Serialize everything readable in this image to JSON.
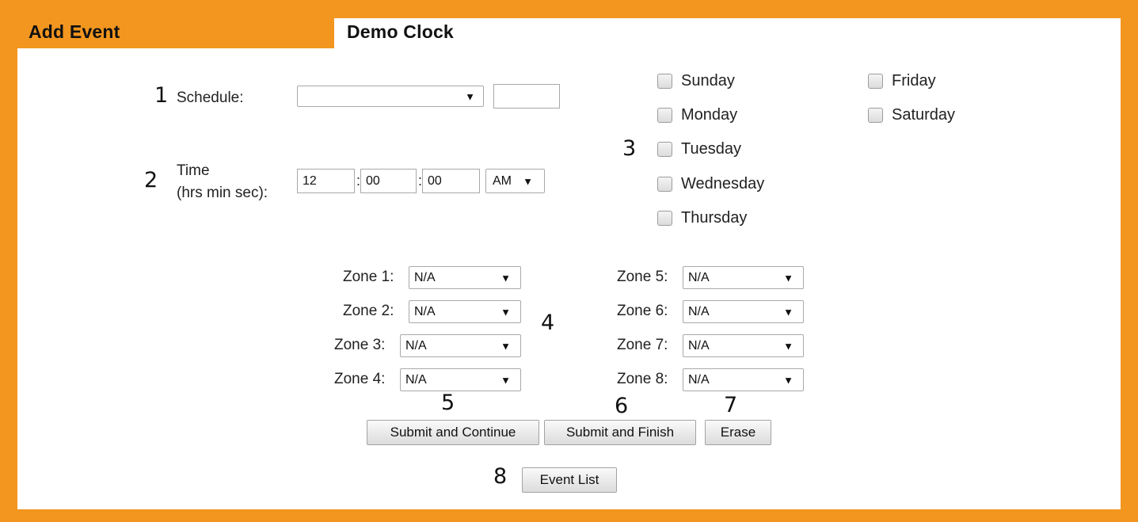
{
  "tabs": {
    "active_title": "Add Event",
    "secondary_title": "Demo Clock"
  },
  "callouts": [
    "1",
    "2",
    "3",
    "4",
    "5",
    "6",
    "7",
    "8"
  ],
  "colors": {
    "frame": "#f2961f",
    "panel": "#ffffff"
  },
  "schedule": {
    "label": "Schedule:",
    "selected": "",
    "text_value": ""
  },
  "time": {
    "label_line1": "Time",
    "label_line2": "(hrs min sec):",
    "hours": "12",
    "minutes": "00",
    "seconds": "00",
    "separator": ":",
    "ampm": "AM"
  },
  "days": [
    "Sunday",
    "Monday",
    "Tuesday",
    "Wednesday",
    "Thursday",
    "Friday",
    "Saturday"
  ],
  "zones": [
    {
      "label": "Zone 1:",
      "value": "N/A"
    },
    {
      "label": "Zone 2:",
      "value": "N/A"
    },
    {
      "label": "Zone 3:",
      "value": "N/A"
    },
    {
      "label": "Zone 4:",
      "value": "N/A"
    },
    {
      "label": "Zone 5:",
      "value": "N/A"
    },
    {
      "label": "Zone 6:",
      "value": "N/A"
    },
    {
      "label": "Zone 7:",
      "value": "N/A"
    },
    {
      "label": "Zone 8:",
      "value": "N/A"
    }
  ],
  "buttons": {
    "submit_continue": "Submit and Continue",
    "submit_finish": "Submit and Finish",
    "erase": "Erase",
    "event_list": "Event List"
  },
  "icons": {
    "dropdown": "chevron-down-icon",
    "dropdown_glyph": "▼"
  }
}
